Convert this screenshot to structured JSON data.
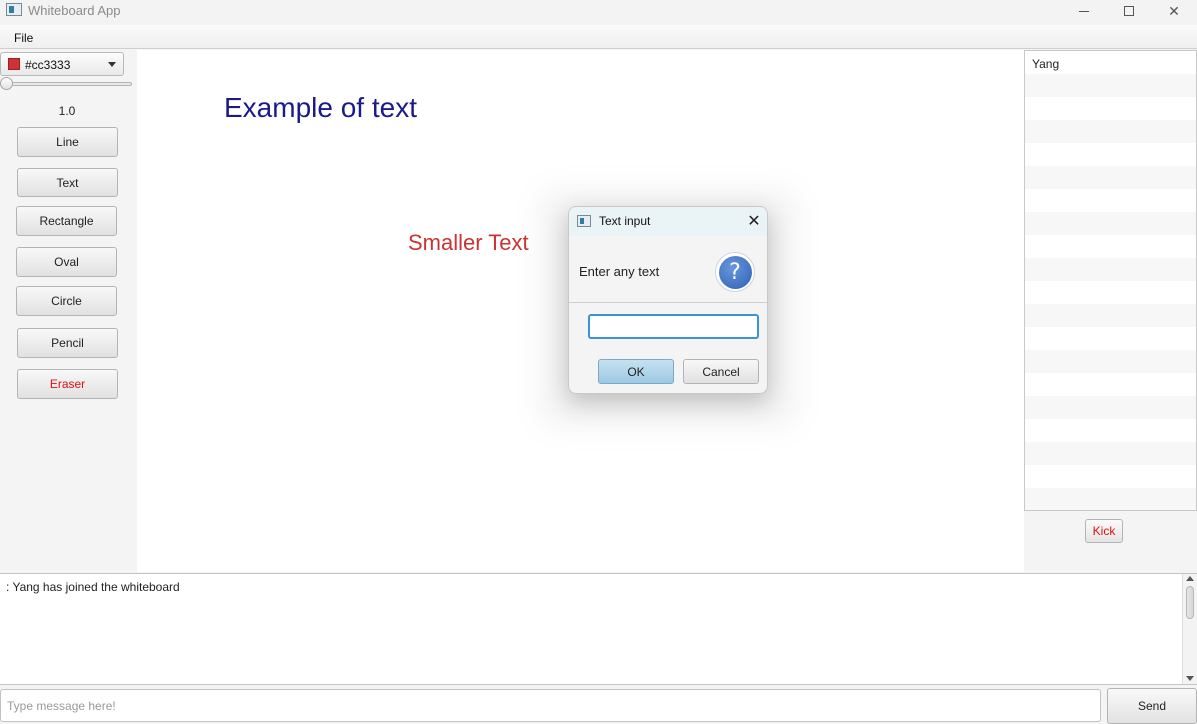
{
  "window": {
    "title": "Whiteboard App",
    "minimize_icon": "minimize-icon",
    "maximize_icon": "maximize-icon",
    "close_icon": "close-icon",
    "close_glyph": "✕"
  },
  "menu": {
    "items": [
      {
        "label": "File"
      }
    ]
  },
  "toolbar": {
    "color": {
      "value": "#cc3333",
      "swatch": "#cc3333"
    },
    "size_slider": {
      "min": 1.0,
      "value": 1.0
    },
    "size_label": "1.0",
    "tools": [
      {
        "label": "Line"
      },
      {
        "label": "Text"
      },
      {
        "label": "Rectangle"
      },
      {
        "label": "Oval"
      },
      {
        "label": "Circle"
      },
      {
        "label": "Pencil"
      },
      {
        "label": "Eraser",
        "color": "#e01010"
      }
    ]
  },
  "canvas": {
    "texts": [
      {
        "text": "Example of text",
        "color": "#1a1a8c"
      },
      {
        "text": "Smaller Text",
        "color": "#cc3333"
      }
    ]
  },
  "users": {
    "items": [
      "Yang"
    ],
    "kick_label": "Kick"
  },
  "chat": {
    "log": [
      ": Yang has joined the whiteboard"
    ],
    "input_placeholder": "Type message here!",
    "input_value": "",
    "send_label": "Send"
  },
  "dialog": {
    "title": "Text input",
    "close_glyph": "✕",
    "prompt": "Enter any text",
    "question_glyph": "?",
    "input_value": "",
    "ok_label": "OK",
    "cancel_label": "Cancel"
  }
}
